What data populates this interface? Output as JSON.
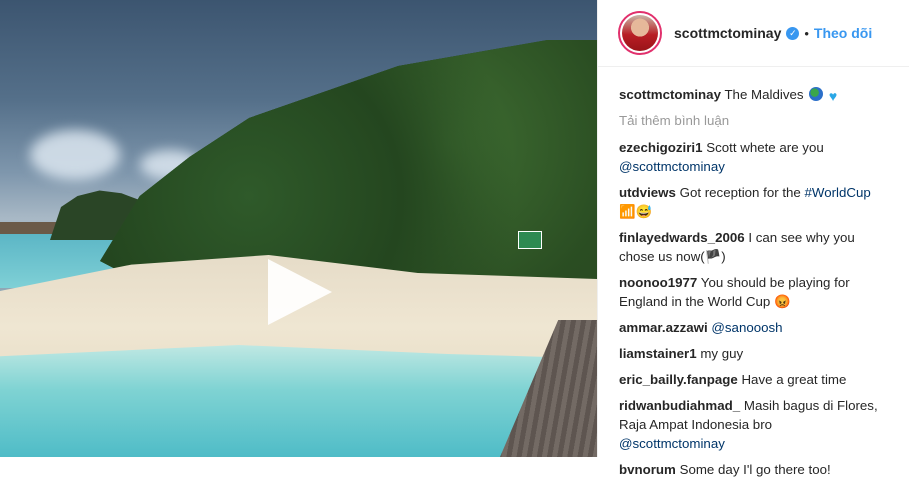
{
  "post": {
    "username": "scottmctominay",
    "verified_badge": "✓",
    "separator": "•",
    "follow_label": "Theo dõi",
    "caption_user": "scottmctominay",
    "caption_text": "The Maldives",
    "caption_emojis": [
      "globe-emoji",
      "blue-heart-emoji"
    ],
    "load_more": "Tải thêm bình luận"
  },
  "comments": [
    {
      "user": "ezechigoziri1",
      "text": "Scott whete are you",
      "mention": "@scottmctominay"
    },
    {
      "user": "utdviews",
      "text": "Got reception for the",
      "hashtag": "#WorldCup",
      "emoji_text": "📶😅"
    },
    {
      "user": "finlayedwards_2006",
      "text": "I can see why you chose us now(🏴)"
    },
    {
      "user": "noonoo1977",
      "text": "You should be playing for England in the World Cup",
      "emoji_text": "😡"
    },
    {
      "user": "ammar.azzawi",
      "mention": "@sanooosh"
    },
    {
      "user": "liamstainer1",
      "text": "my guy"
    },
    {
      "user": "eric_bailly.fanpage",
      "text": "Have a great time"
    },
    {
      "user": "ridwanbudiahmad_",
      "text": "Masih bagus di Flores, Raja Ampat Indonesia bro",
      "mention": "@scottmctominay"
    },
    {
      "user": "bvnorum",
      "text": "Some day I'l go there too!"
    }
  ],
  "colors": {
    "link": "#003569",
    "follow": "#3897f0",
    "muted": "#999999"
  }
}
